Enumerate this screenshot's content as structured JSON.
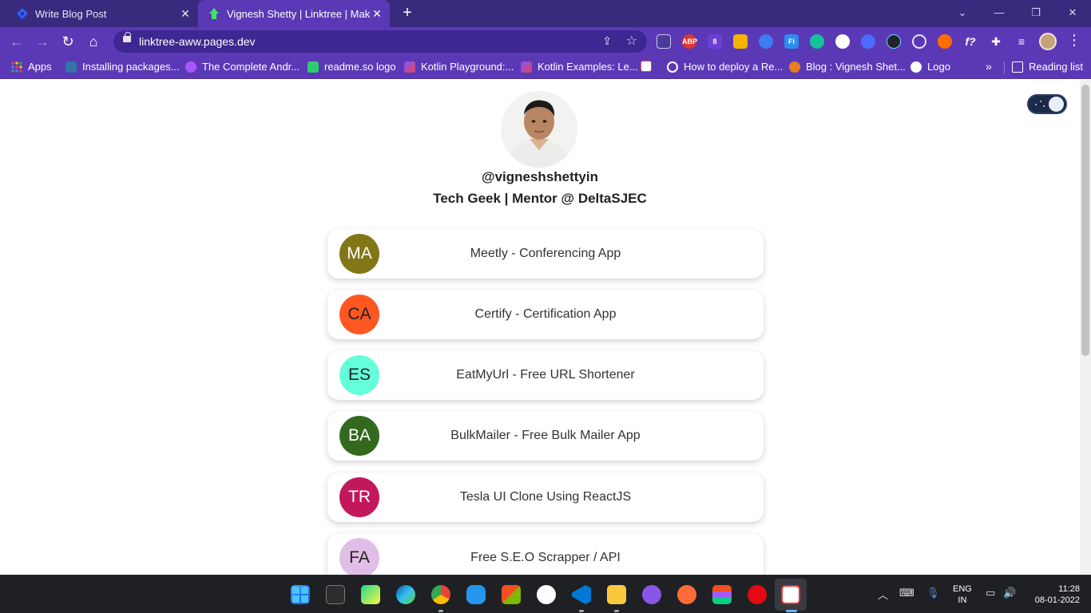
{
  "browser": {
    "tabs": [
      {
        "title": "Write Blog Post",
        "active": false
      },
      {
        "title": "Vignesh Shetty | Linktree | Make your own Linktree",
        "active": true
      }
    ],
    "new_tab_label": "+",
    "address": "linktree-aww.pages.dev",
    "bookmarks": [
      {
        "label": "Apps",
        "icon_color": "#ea4335"
      },
      {
        "label": "Installing packages...",
        "icon_color": "#3572a5"
      },
      {
        "label": "The Complete Andr...",
        "icon_color": "#8e44ad"
      },
      {
        "label": "readme.so logo",
        "icon_color": "#2ecc71"
      },
      {
        "label": "Kotlin Playground:...",
        "icon_color": "#7f52ff"
      },
      {
        "label": "Kotlin Examples: Le...",
        "icon_color": "#7f52ff"
      },
      {
        "label": "",
        "icon_color": "#e74c3c"
      },
      {
        "label": "How to deploy a Re...",
        "icon_color": "#ffffff"
      },
      {
        "label": "Blog : Vignesh Shet...",
        "icon_color": "#e67e22"
      },
      {
        "label": "Logo",
        "icon_color": "#ffffff"
      }
    ],
    "reading_list_label": "Reading list",
    "extensions": [
      "ABP",
      "8",
      "Fi",
      "f?"
    ]
  },
  "profile": {
    "username": "@vigneshshettyin",
    "bio": "Tech Geek | Mentor @ DeltaSJEC"
  },
  "links": [
    {
      "initials": "MA",
      "title": "Meetly - Conferencing App",
      "color": "#827717",
      "text_color": "#ffffff"
    },
    {
      "initials": "CA",
      "title": "Certify - Certification App",
      "color": "#ff5722",
      "text_color": "#222222"
    },
    {
      "initials": "ES",
      "title": "EatMyUrl - Free URL Shortener",
      "color": "#64ffda",
      "text_color": "#222222"
    },
    {
      "initials": "BA",
      "title": "BulkMailer - Free Bulk Mailer App",
      "color": "#33691e",
      "text_color": "#ffffff"
    },
    {
      "initials": "TR",
      "title": "Tesla UI Clone Using ReactJS",
      "color": "#c2185b",
      "text_color": "#ffffff"
    },
    {
      "initials": "FA",
      "title": "Free S.E.O Scrapper / API",
      "color": "#e1bee7",
      "text_color": "#222222"
    }
  ],
  "theme_toggle": {
    "state": "dark"
  },
  "taskbar": {
    "lang_line1": "ENG",
    "lang_line2": "IN",
    "time": "11:28",
    "date": "08-01-2022"
  }
}
